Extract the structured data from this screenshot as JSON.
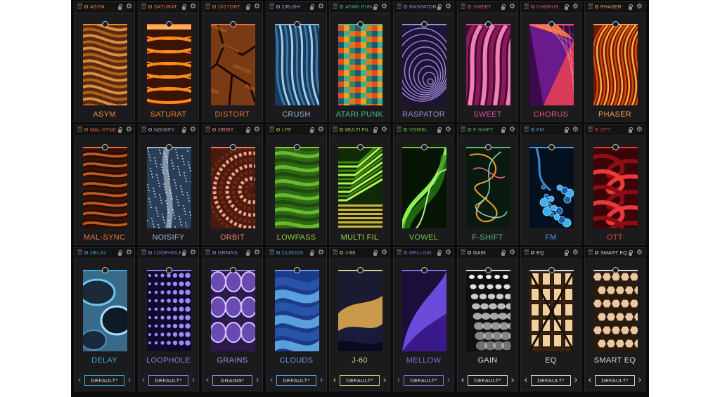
{
  "rows": [
    {
      "modules": [
        {
          "header": "ASYM",
          "title": "ASYM",
          "accent": "#e88a3c",
          "icons": {
            "menu": "menu-icon",
            "power": "power-icon",
            "lock": "lock-icon",
            "settings": "gear-icon"
          },
          "art": "brown-wavy-rock-texture"
        },
        {
          "header": "SATURAT",
          "title": "SATURAT",
          "accent": "#f07a28",
          "icons": {
            "menu": "menu-icon",
            "power": "power-icon",
            "lock": "lock-icon",
            "settings": "gear-icon"
          },
          "art": "glowing-orange-rings"
        },
        {
          "header": "DISTORT",
          "title": "DISTORT",
          "accent": "#e8703a",
          "icons": {
            "menu": "menu-icon",
            "power": "power-icon",
            "lock": "lock-icon",
            "settings": "gear-icon"
          },
          "art": "cracked-earth-texture"
        },
        {
          "header": "CRUSH",
          "title": "CRUSH",
          "accent": "#8fb8d8",
          "icons": {
            "menu": "menu-icon",
            "power": "power-icon",
            "lock": "lock-icon",
            "settings": "gear-icon"
          },
          "art": "blue-fibrous-texture"
        },
        {
          "header": "ATARI PUNK",
          "title": "ATARI PUNK",
          "accent": "#3fbf8f",
          "icons": {
            "menu": "menu-icon",
            "power": "power-icon",
            "lock": "lock-icon",
            "settings": "gear-icon"
          },
          "art": "pixel-mosaic"
        },
        {
          "header": "RASPATOR",
          "title": "RASPATOR",
          "accent": "#9b8ad8",
          "icons": {
            "menu": "menu-icon",
            "power": "power-icon",
            "lock": "lock-icon",
            "settings": "gear-icon"
          },
          "art": "purple-spiral-tunnel"
        },
        {
          "header": "SWEET",
          "title": "SWEET",
          "accent": "#d04f9a",
          "icons": {
            "menu": "menu-icon",
            "power": "power-icon",
            "lock": "lock-icon",
            "settings": "gear-icon"
          },
          "art": "magenta-fabric-folds"
        },
        {
          "header": "CHORUS",
          "title": "CHORUS",
          "accent": "#e85a6a",
          "icons": {
            "menu": "menu-icon",
            "power": "power-icon",
            "lock": "lock-icon",
            "settings": "gear-icon"
          },
          "art": "geometric-prism"
        },
        {
          "header": "PHASER",
          "title": "PHASER",
          "accent": "#f0a040",
          "icons": {
            "menu": "menu-icon",
            "power": "power-icon",
            "lock": "lock-icon",
            "settings": "gear-icon"
          },
          "art": "orange-flowing-lines"
        }
      ]
    },
    {
      "modules": [
        {
          "header": "MAL-SYNC",
          "title": "MAL-SYNC",
          "accent": "#e8703a",
          "icons": {
            "menu": "menu-icon",
            "power": "power-icon",
            "lock": "lock-icon",
            "settings": "gear-icon"
          },
          "art": "dark-wood-grain"
        },
        {
          "header": "NOISIFY",
          "title": "NOISIFY",
          "accent": "#9ab0c8",
          "icons": {
            "menu": "menu-icon",
            "power": "power-icon",
            "lock": "lock-icon",
            "settings": "gear-icon"
          },
          "art": "noisy-blue-waterfall"
        },
        {
          "header": "ORBIT",
          "title": "ORBIT",
          "accent": "#e88060",
          "icons": {
            "menu": "menu-icon",
            "power": "power-icon",
            "lock": "lock-icon",
            "settings": "gear-icon"
          },
          "art": "copper-mandala"
        },
        {
          "header": "LPF",
          "title": "LOWPASS",
          "accent": "#8ac83a",
          "icons": {
            "menu": "menu-icon",
            "power": "power-icon",
            "lock": "lock-icon",
            "settings": "gear-icon"
          },
          "art": "green-dunes"
        },
        {
          "header": "MULTI FIL",
          "title": "MULTI FIL",
          "accent": "#9ad83a",
          "icons": {
            "menu": "menu-icon",
            "power": "power-icon",
            "lock": "lock-icon",
            "settings": "gear-icon"
          },
          "art": "green-stepped-lines"
        },
        {
          "header": "VOWEL",
          "title": "VOWEL",
          "accent": "#6ac83a",
          "icons": {
            "menu": "menu-icon",
            "power": "power-icon",
            "lock": "lock-icon",
            "settings": "gear-icon"
          },
          "art": "green-leaf-swirl"
        },
        {
          "header": "F-SHIFT",
          "title": "F-SHIFT",
          "accent": "#5ab870",
          "icons": {
            "menu": "menu-icon",
            "power": "power-icon",
            "lock": "lock-icon",
            "settings": "gear-icon"
          },
          "art": "tangled-neon-wires"
        },
        {
          "header": "FM",
          "title": "FM",
          "accent": "#4a9ae8",
          "icons": {
            "menu": "menu-icon",
            "power": "power-icon",
            "lock": "lock-icon",
            "settings": "gear-icon"
          },
          "art": "blue-bubbles"
        },
        {
          "header": "OTT",
          "title": "OTT",
          "accent": "#e83a3a",
          "icons": {
            "menu": "menu-icon",
            "power": "power-icon",
            "lock": "lock-icon",
            "settings": "gear-icon"
          },
          "art": "red-curled-ribbons"
        }
      ]
    },
    {
      "modules": [
        {
          "header": "DELAY",
          "title": "DELAY",
          "accent": "#3aa8d8",
          "icons": {
            "menu": "menu-icon",
            "power": "power-icon",
            "lock": "lock-icon",
            "settings": "gear-icon"
          },
          "art": "blue-blobs",
          "preset": "DEFAULT*",
          "icons_preset": {
            "prev": "chevron-left-icon",
            "next": "chevron-right-icon"
          }
        },
        {
          "header": "LOOPHOLE",
          "title": "LOOPHOLE",
          "accent": "#8a7ae8",
          "icons": {
            "menu": "menu-icon",
            "power": "power-icon",
            "lock": "lock-icon",
            "settings": "gear-icon"
          },
          "art": "violet-dot-grid",
          "preset": "DEFAULT*",
          "icons_preset": {
            "prev": "chevron-left-icon",
            "next": "chevron-right-icon"
          }
        },
        {
          "header": "GRAINS",
          "title": "GRAINS",
          "accent": "#a08ae0",
          "icons": {
            "menu": "menu-icon",
            "power": "power-icon",
            "lock": "lock-icon",
            "settings": "gear-icon"
          },
          "art": "purple-cells",
          "preset": "GRAINS*",
          "icons_preset": {
            "prev": "chevron-left-icon",
            "next": "chevron-right-icon"
          }
        },
        {
          "header": "CLOUDS",
          "title": "CLOUDS",
          "accent": "#6a9ae8",
          "icons": {
            "menu": "menu-icon",
            "power": "power-icon",
            "lock": "lock-icon",
            "settings": "gear-icon"
          },
          "art": "blue-waves",
          "preset": "DEFAULT*",
          "icons_preset": {
            "prev": "chevron-left-icon",
            "next": "chevron-right-icon"
          }
        },
        {
          "header": "J-60",
          "title": "J-60",
          "accent": "#d8c88a",
          "icons": {
            "menu": "menu-icon",
            "power": "power-icon",
            "lock": "lock-icon",
            "settings": "gear-icon"
          },
          "art": "night-desert-dunes",
          "preset": "DEFAULT*",
          "icons_preset": {
            "prev": "chevron-left-icon",
            "next": "chevron-right-icon"
          }
        },
        {
          "header": "MELLOW",
          "title": "MELLOW",
          "accent": "#8a6ae0",
          "icons": {
            "menu": "menu-icon",
            "power": "power-icon",
            "lock": "lock-icon",
            "settings": "gear-icon"
          },
          "art": "purple-gradient-curve",
          "preset": "DEFAULT*",
          "icons_preset": {
            "prev": "chevron-left-icon",
            "next": "chevron-right-icon"
          }
        },
        {
          "header": "GAIN",
          "title": "GAIN",
          "accent": "#d8d8d8",
          "icons": {
            "menu": "menu-icon",
            "power": "power-icon",
            "lock": "lock-icon",
            "settings": "gear-icon"
          },
          "art": "white-dot-perspective",
          "preset": "DEFAULT*",
          "icons_preset": {
            "prev": "chevron-left-icon",
            "next": "chevron-right-icon"
          }
        },
        {
          "header": "EQ",
          "title": "EQ",
          "accent": "#d8d8d8",
          "icons": {
            "menu": "menu-icon",
            "power": "power-icon",
            "lock": "lock-icon",
            "settings": "gear-icon"
          },
          "art": "lattice-dome",
          "preset": "DEFAULT*",
          "icons_preset": {
            "prev": "chevron-left-icon",
            "next": "chevron-right-icon"
          }
        },
        {
          "header": "SMART EQ",
          "title": "SMART EQ",
          "accent": "#d8d8d8",
          "icons": {
            "menu": "menu-icon",
            "power": "power-icon",
            "lock": "lock-icon",
            "settings": "gear-icon"
          },
          "art": "honeycomb-dome",
          "preset": "DEFAULT*",
          "icons_preset": {
            "prev": "chevron-left-icon",
            "next": "chevron-right-icon"
          }
        }
      ]
    }
  ]
}
